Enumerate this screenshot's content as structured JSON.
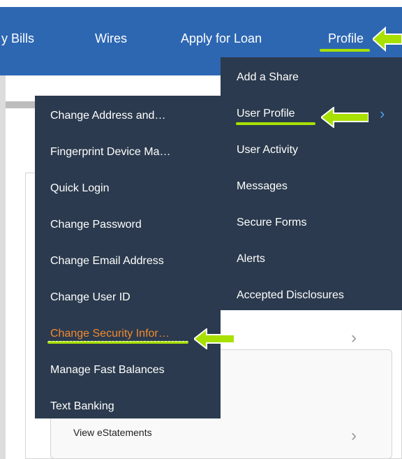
{
  "nav": {
    "pay_bills": "y Bills",
    "wires": "Wires",
    "apply_for_loan": "Apply for Loan",
    "profile": "Profile"
  },
  "profile_menu": {
    "items": [
      "Add a Share",
      "User Profile",
      "User Activity",
      "Messages",
      "Secure Forms",
      "Alerts",
      "Accepted Disclosures"
    ]
  },
  "user_profile_submenu": {
    "items": [
      "Change Address and…",
      "Fingerprint Device Ma…",
      "Quick Login",
      "Change Password",
      "Change Email Address",
      "Change User ID",
      "Change Security Infor…",
      "Manage Fast Balances",
      "Text Banking"
    ],
    "active_item": "Change Security Infor…"
  },
  "page": {
    "view_estatements": "View eStatements"
  },
  "icons": {
    "submenu_indicator": "chevron-right-icon",
    "row_chevron": "chevron-right-icon",
    "callout": "green-arrow-left-icon"
  },
  "colors": {
    "nav_bg": "#2d67b2",
    "menu_bg": "#2b3a4e",
    "highlight_green": "#a8e000",
    "active_orange": "#f28a30",
    "chevron_blue": "#4aa3e8"
  }
}
